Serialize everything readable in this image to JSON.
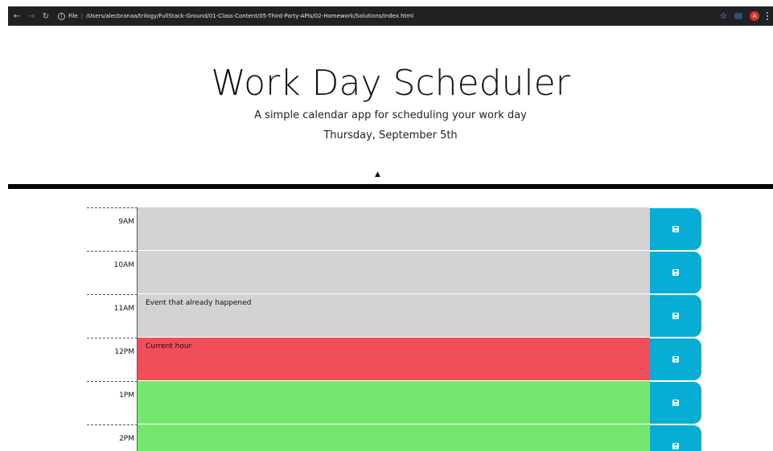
{
  "browser": {
    "protocol_label": "File",
    "url": "/Users/alecbranaa/trilogy/FullStack-Ground/01-Class-Content/05-Third-Party-APIs/02-Homework/Solutions/index.html",
    "back_icon": "arrow-left-icon",
    "forward_icon": "arrow-right-icon",
    "reload_icon": "reload-icon",
    "info_icon": "info-icon",
    "bookmark_icon": "star-icon",
    "menu_icon": "kebab-menu-icon"
  },
  "header": {
    "title": "Work Day Scheduler",
    "lead": "A simple calendar app for scheduling your work day",
    "current_day": "Thursday, September 5th"
  },
  "colors": {
    "past": "#d3d3d3",
    "present": "#f14e5a",
    "future": "#76e76e",
    "save_button": "#06aed5",
    "divider": "#000000"
  },
  "schedule": {
    "save_icon": "floppy-disk-icon",
    "blocks": [
      {
        "hour": "9AM",
        "text": "",
        "status": "past"
      },
      {
        "hour": "10AM",
        "text": "",
        "status": "past"
      },
      {
        "hour": "11AM",
        "text": "Event that already happened",
        "status": "past"
      },
      {
        "hour": "12PM",
        "text": "Current hour",
        "status": "present"
      },
      {
        "hour": "1PM",
        "text": "",
        "status": "future"
      },
      {
        "hour": "2PM",
        "text": "",
        "status": "future"
      }
    ]
  }
}
